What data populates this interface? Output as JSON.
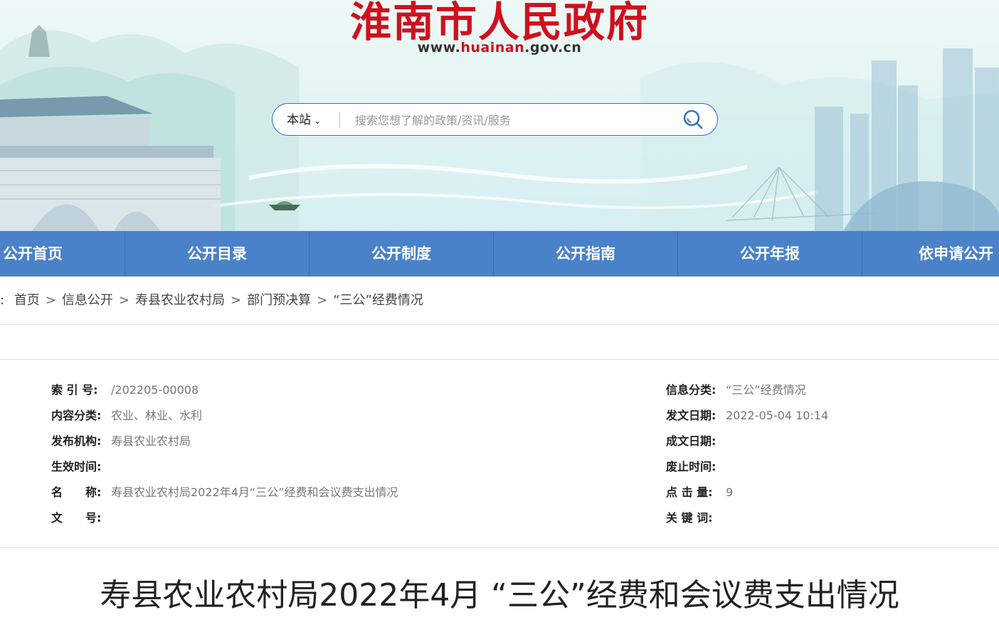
{
  "header": {
    "site_title": "淮南市人民政府",
    "site_url_prefix": "www.",
    "site_url_highlight": "huainan",
    "site_url_suffix": ".gov.cn"
  },
  "search": {
    "scope": "本站",
    "placeholder": "搜索您想了解的政策/资讯/服务"
  },
  "nav": {
    "items": [
      "公开首页",
      "公开目录",
      "公开制度",
      "公开指南",
      "公开年报",
      "依申请公开"
    ]
  },
  "breadcrumb": {
    "prefix": ":",
    "items": [
      "首页",
      "信息公开",
      "寿县农业农村局",
      "部门预决算",
      "“三公”经费情况"
    ],
    "separator": ">"
  },
  "meta": {
    "left": [
      {
        "label": "索 引 号:",
        "value": "/202205-00008"
      },
      {
        "label": "内容分类:",
        "value": "农业、林业、水利"
      },
      {
        "label": "发布机构:",
        "value": "寿县农业农村局"
      },
      {
        "label": "生效时间:",
        "value": ""
      },
      {
        "label": "名　　称:",
        "value": "寿县农业农村局2022年4月“三公”经费和会议费支出情况"
      },
      {
        "label": "文　　号:",
        "value": ""
      }
    ],
    "right": [
      {
        "label": "信息分类:",
        "value": "“三公”经费情况"
      },
      {
        "label": "发文日期:",
        "value": "2022-05-04 10:14"
      },
      {
        "label": "成文日期:",
        "value": ""
      },
      {
        "label": "废止时间:",
        "value": ""
      },
      {
        "label": "点 击 量:",
        "value": "9"
      },
      {
        "label": "关 键 词:",
        "value": ""
      }
    ]
  },
  "article": {
    "title": "寿县农业农村局2022年4月 “三公”经费和会议费支出情况"
  },
  "colors": {
    "brand_red": "#d0101d",
    "nav_blue": "#4a82c9",
    "search_border": "#3a72c4"
  }
}
